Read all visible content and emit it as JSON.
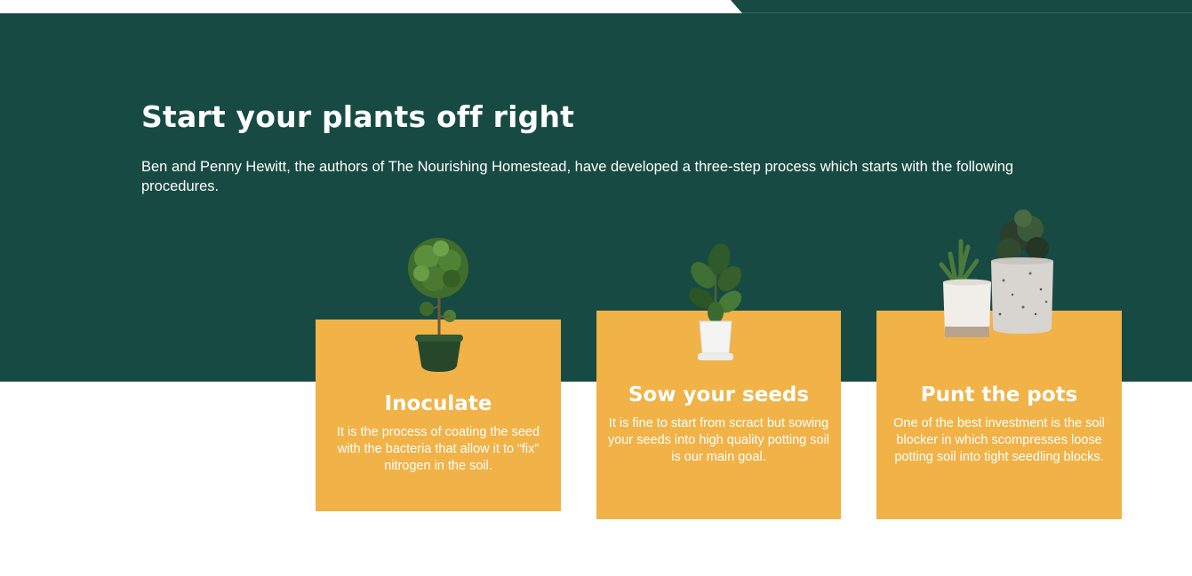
{
  "hero": {
    "title": "Start your plants off right",
    "intro": "Ben and Penny Hewitt, the authors of The Nourishing Homestead, have developed a three-step process which starts with the following procedures."
  },
  "cards": [
    {
      "title": "Inoculate",
      "text": "It is the process of coating the seed with the bacteria that allow it to “fix” nitrogen in the soil.",
      "icon": "topiary-plant-icon"
    },
    {
      "title": "Sow your seeds",
      "text": "It is fine to start from scract but sowing your seeds into high quality potting soil is our main goal.",
      "icon": "fiddle-leaf-plant-icon"
    },
    {
      "title": "Punt the pots",
      "text": "One of the best investment is the soil blocker in which scompresses loose potting soil into tight seedling blocks.",
      "icon": "concrete-pots-plant-icon"
    }
  ],
  "colors": {
    "hero_background": "#174a43",
    "card_background": "#f1b247",
    "text_light": "#ffffff"
  }
}
